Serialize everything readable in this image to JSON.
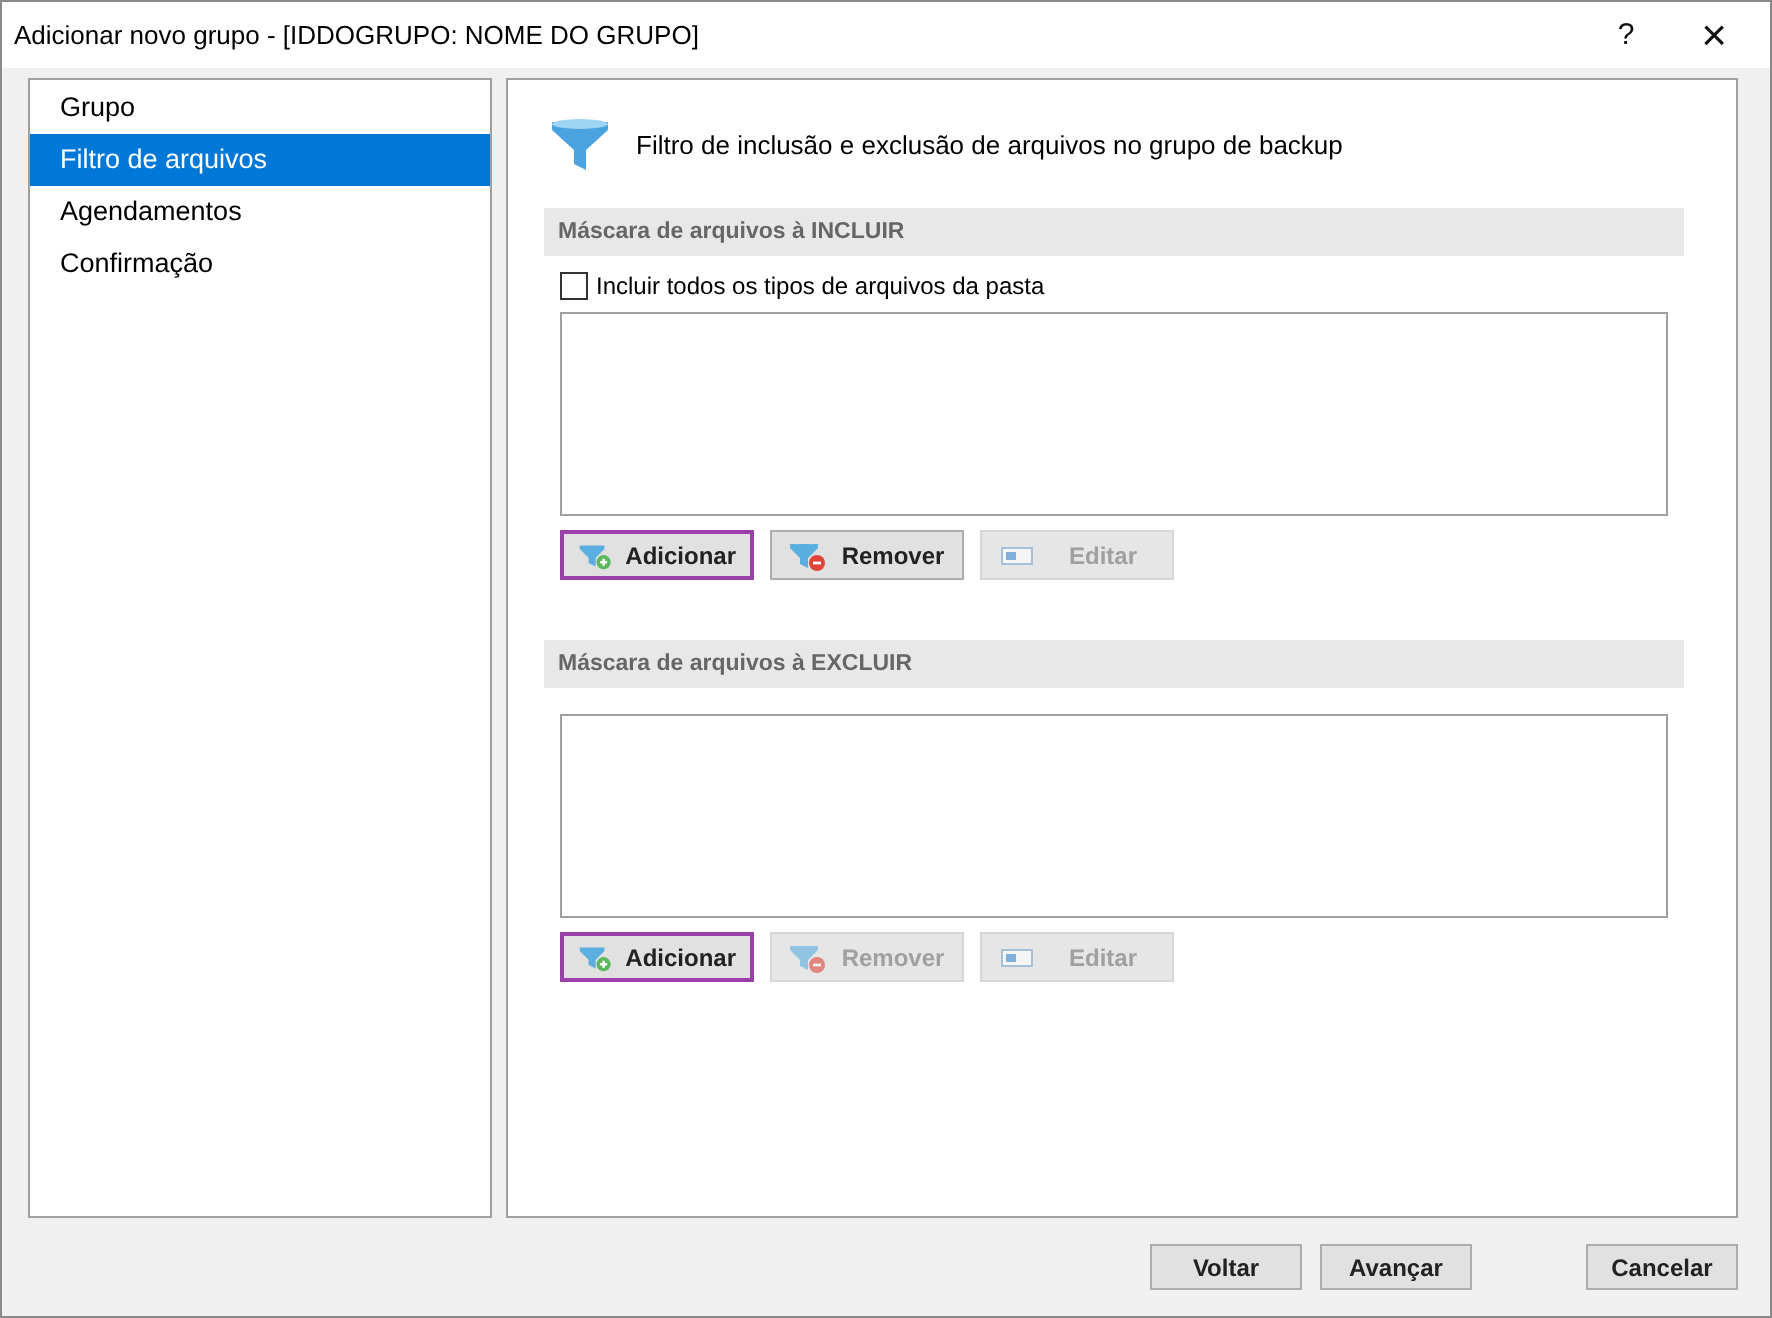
{
  "window": {
    "title": "Adicionar novo grupo - [IDDOGRUPO: NOME DO GRUPO]",
    "help": "?",
    "close": "×"
  },
  "sidebar": {
    "items": [
      {
        "label": "Grupo",
        "selected": false
      },
      {
        "label": "Filtro de arquivos",
        "selected": true
      },
      {
        "label": "Agendamentos",
        "selected": false
      },
      {
        "label": "Confirmação",
        "selected": false
      }
    ]
  },
  "heading": "Filtro de inclusão e exclusão de arquivos no grupo de backup",
  "sections": [
    {
      "title": "Máscara de arquivos à INCLUIR",
      "checkbox": {
        "label": "Incluir todos os tipos de arquivos da pasta",
        "checked": false
      },
      "buttons": [
        {
          "label": "Adicionar",
          "kind": "add",
          "disabled": false,
          "focused": true
        },
        {
          "label": "Remover",
          "kind": "remove",
          "disabled": false,
          "focused": false
        },
        {
          "label": "Editar",
          "kind": "edit",
          "disabled": true,
          "focused": false
        }
      ]
    },
    {
      "title": "Máscara de arquivos à EXCLUIR",
      "buttons": [
        {
          "label": "Adicionar",
          "kind": "add",
          "disabled": false,
          "focused": true
        },
        {
          "label": "Remover",
          "kind": "remove",
          "disabled": true,
          "focused": false
        },
        {
          "label": "Editar",
          "kind": "edit",
          "disabled": true,
          "focused": false
        }
      ]
    }
  ],
  "footer": {
    "buttons": [
      "Voltar",
      "Avançar",
      "Cancelar"
    ]
  }
}
